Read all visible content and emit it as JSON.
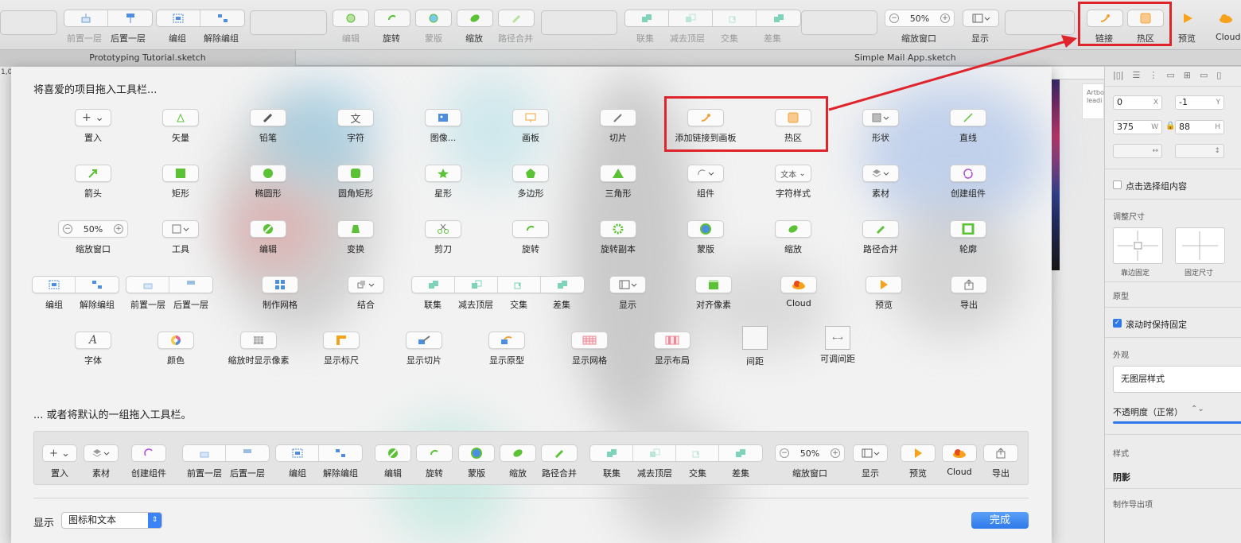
{
  "top_toolbar": {
    "items": [
      "前置一层",
      "后置一层",
      "编组",
      "解除编组",
      "编辑",
      "旋转",
      "蒙版",
      "缩放",
      "路径合并",
      "联集",
      "减去顶层",
      "交集",
      "差集",
      "缩放窗口",
      "显示",
      "链接",
      "热区",
      "预览",
      "Cloud"
    ],
    "zoom": "50%"
  },
  "tabs": [
    "Prototyping Tutorial.sketch",
    "Simple Mail App.sketch"
  ],
  "sheet": {
    "title": "将喜爱的项目拖入工具栏...",
    "rows": [
      [
        "置入",
        "矢量",
        "铅笔",
        "字符",
        "图像...",
        "画板",
        "切片",
        "添加链接到画板",
        "热区",
        "形状",
        "直线"
      ],
      [
        "箭头",
        "矩形",
        "椭圆形",
        "圆角矩形",
        "星形",
        "多边形",
        "三角形",
        "组件",
        "字符样式",
        "素材",
        "创建组件"
      ],
      [
        "缩放窗口",
        "工具",
        "编辑",
        "变换",
        "剪刀",
        "旋转",
        "旋转副本",
        "蒙版",
        "缩放",
        "路径合并",
        "轮廓"
      ],
      [
        "编组",
        "解除编组",
        "前置一层",
        "后置一层",
        "制作网格",
        "结合",
        "联集",
        "减去顶层",
        "交集",
        "差集",
        "显示",
        "对齐像素",
        "Cloud",
        "预览",
        "导出"
      ],
      [
        "字体",
        "颜色",
        "缩放时显示像素",
        "显示标尺",
        "显示切片",
        "显示原型",
        "显示网格",
        "显示布局",
        "间距",
        "可调间距"
      ]
    ],
    "zoom": "50%",
    "text_style_btn": "文本",
    "default_title": "... 或者将默认的一组拖入工具栏。",
    "defaults": [
      "置入",
      "素材",
      "创建组件",
      "前置一层",
      "后置一层",
      "编组",
      "解除编组",
      "编辑",
      "旋转",
      "蒙版",
      "缩放",
      "路径合并",
      "联集",
      "减去顶层",
      "交集",
      "差集",
      "缩放窗口",
      "显示",
      "预览",
      "Cloud",
      "导出"
    ],
    "show_label": "显示",
    "show_value": "图标和文本",
    "done_label": "完成"
  },
  "inspector": {
    "x": "0",
    "y": "-1",
    "w": "375",
    "h": "88",
    "x_unit": "X",
    "y_unit": "Y",
    "w_unit": "W",
    "h_unit": "H",
    "click_through": "点击选择组内容",
    "resizing": "调整尺寸",
    "pin_edge": "靠边固定",
    "fix_size": "固定尺寸",
    "prototype": "原型",
    "fix_scroll": "滚动时保持固定",
    "appearance": "外观",
    "no_style": "无图层样式",
    "opacity": "不透明度（正常）",
    "style": "样式",
    "shadow": "阴影",
    "export": "制作导出项"
  },
  "canvas": {
    "ruler_label": "1,0",
    "artboard_text_1": "Artbo",
    "artboard_text_2": "leadi"
  },
  "colors": {
    "accent_green": "#5bc236",
    "highlight_red": "#e0242b",
    "blue": "#2f79ea",
    "orange": "#f2a33a"
  }
}
